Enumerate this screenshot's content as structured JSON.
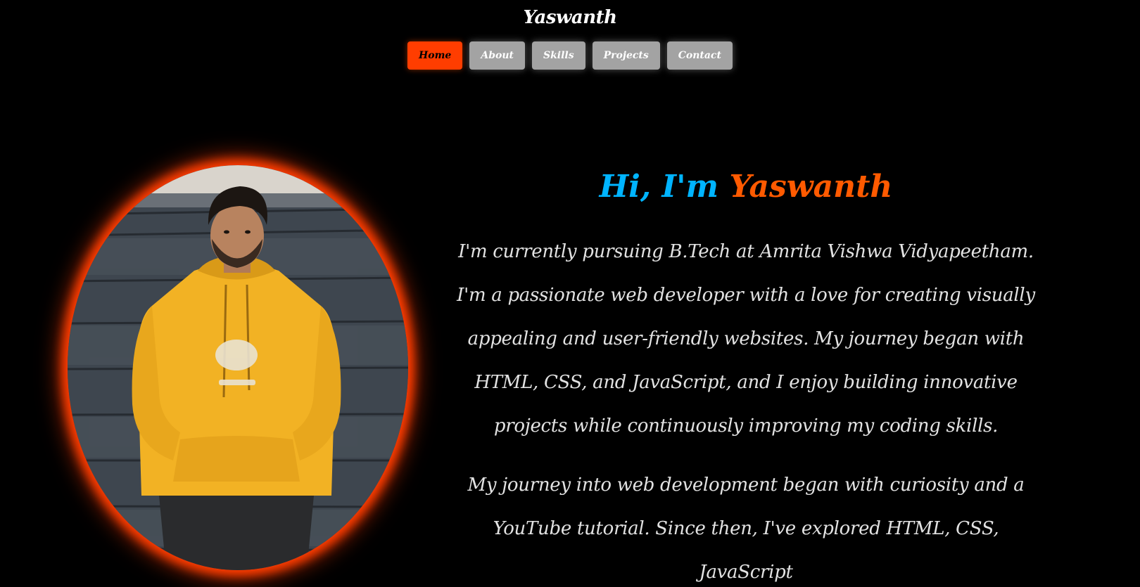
{
  "header": {
    "site_title": "Yaswanth"
  },
  "nav": {
    "items": [
      {
        "label": "Home",
        "active": true
      },
      {
        "label": "About",
        "active": false
      },
      {
        "label": "Skills",
        "active": false
      },
      {
        "label": "Projects",
        "active": false
      },
      {
        "label": "Contact",
        "active": false
      }
    ]
  },
  "hero": {
    "greeting": "Hi, I'm",
    "name": "Yaswanth",
    "paragraph_1": "I'm currently pursuing B.Tech at Amrita Vishwa Vidyapeetham. I'm a passionate web developer with a love for creating visually appealing and user-friendly websites. My journey began with HTML, CSS, and JavaScript, and I enjoy building innovative projects while continuously improving my coding skills.",
    "paragraph_2": "My journey into web development began with curiosity and a YouTube tutorial. Since then, I've explored HTML, CSS, JavaScript"
  },
  "colors": {
    "accent": "#ff3d00",
    "greeting": "#00b4ff",
    "name": "#ff5a00",
    "nav_inactive": "#a3a3a3",
    "background": "#000000"
  }
}
